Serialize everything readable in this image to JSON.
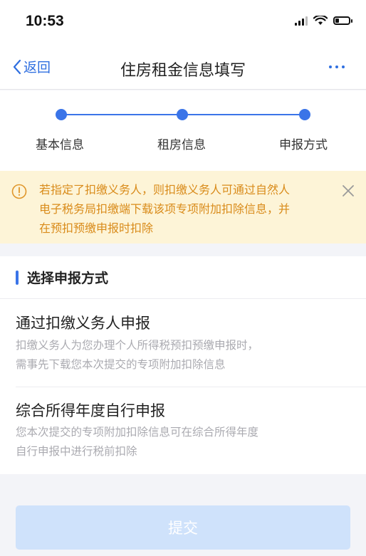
{
  "status_bar": {
    "time": "10:53"
  },
  "nav": {
    "back_label": "返回",
    "title": "住房租金信息填写"
  },
  "steps": [
    {
      "label": "基本信息"
    },
    {
      "label": "租房信息"
    },
    {
      "label": "申报方式"
    }
  ],
  "notice": {
    "lines": [
      "若指定了扣缴义务人，则扣缴义务人可通过自然人",
      "电子税务局扣缴端下载该项专项附加扣除信息，并",
      "在预扣预缴申报时扣除"
    ]
  },
  "section": {
    "title": "选择申报方式",
    "options": [
      {
        "title": "通过扣缴义务人申报",
        "desc_lines": [
          "扣缴义务人为您办理个人所得税预扣预缴申报时，",
          "需事先下载您本次提交的专项附加扣除信息"
        ]
      },
      {
        "title": "综合所得年度自行申报",
        "desc_lines": [
          "您本次提交的专项附加扣除信息可在综合所得年度",
          "自行申报中进行税前扣除"
        ]
      }
    ]
  },
  "submit": {
    "label": "提交"
  },
  "colors": {
    "accent": "#3a74e8",
    "notice_text": "#d98b1a",
    "notice_bg": "#fdf4d7",
    "submit_disabled": "#cfe2fb"
  }
}
